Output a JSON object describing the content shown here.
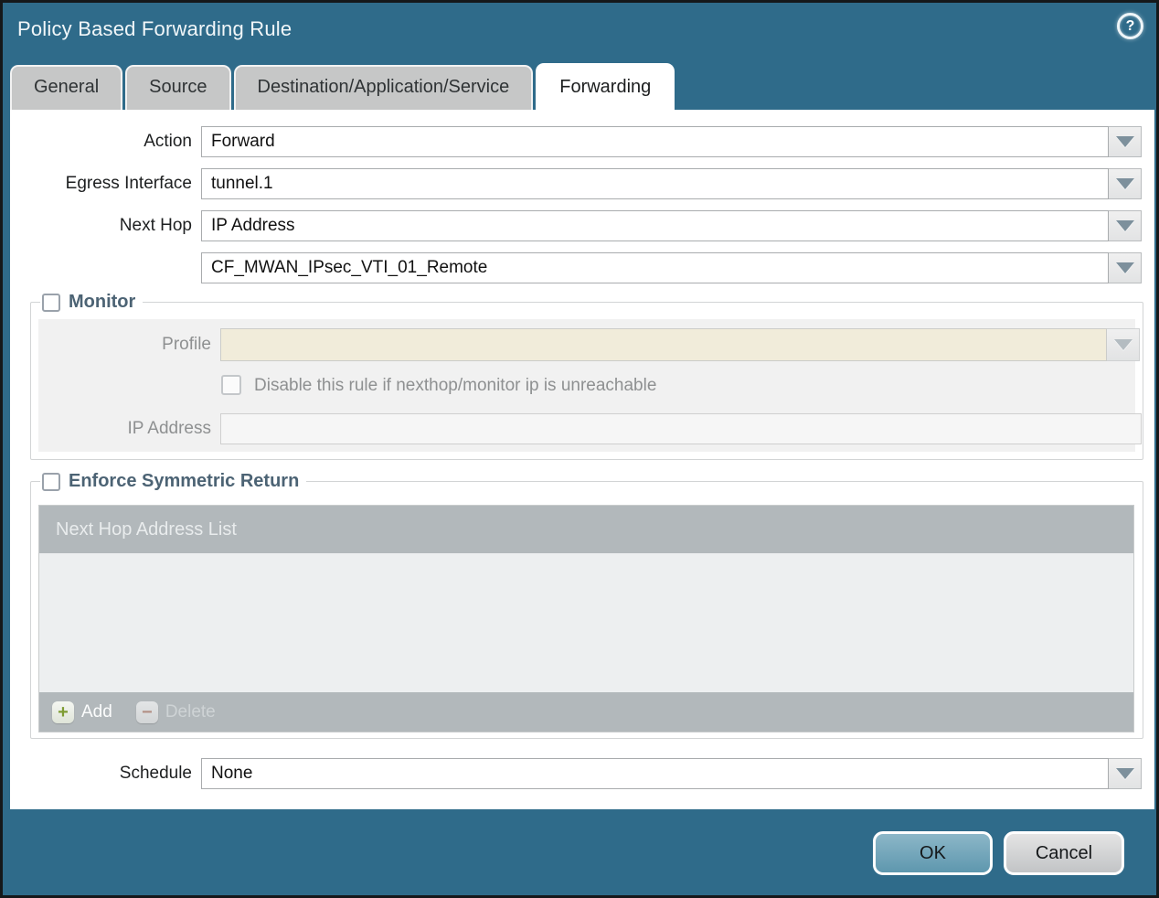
{
  "dialog": {
    "title": "Policy Based Forwarding Rule",
    "help_glyph": "?"
  },
  "tabs": [
    {
      "label": "General",
      "active": false
    },
    {
      "label": "Source",
      "active": false
    },
    {
      "label": "Destination/Application/Service",
      "active": false
    },
    {
      "label": "Forwarding",
      "active": true
    }
  ],
  "form": {
    "action": {
      "label": "Action",
      "value": "Forward"
    },
    "egress_interface": {
      "label": "Egress Interface",
      "value": "tunnel.1"
    },
    "next_hop": {
      "label": "Next Hop",
      "value": "IP Address"
    },
    "next_hop_address": {
      "value": "CF_MWAN_IPsec_VTI_01_Remote"
    },
    "schedule": {
      "label": "Schedule",
      "value": "None"
    }
  },
  "monitor": {
    "legend": "Monitor",
    "checked": false,
    "profile": {
      "label": "Profile",
      "value": ""
    },
    "disable_rule_label": "Disable this rule if nexthop/monitor ip is unreachable",
    "disable_rule_checked": false,
    "ip_address": {
      "label": "IP Address",
      "value": ""
    }
  },
  "symmetric_return": {
    "legend": "Enforce Symmetric Return",
    "checked": false,
    "table_header": "Next Hop Address List",
    "rows": [],
    "add_label": "Add",
    "delete_label": "Delete",
    "delete_enabled": false
  },
  "footer": {
    "ok_label": "OK",
    "cancel_label": "Cancel"
  },
  "colors": {
    "frame_teal": "#2f6b8a",
    "tab_inactive": "#c6c7c7",
    "legend_text": "#4c6374",
    "grid_bar": "#b2b8bb",
    "profile_field": "#f1ecda",
    "add_plus": "#7f9c33",
    "delete_minus": "#b29086",
    "ok_button": "#5e97ae"
  }
}
